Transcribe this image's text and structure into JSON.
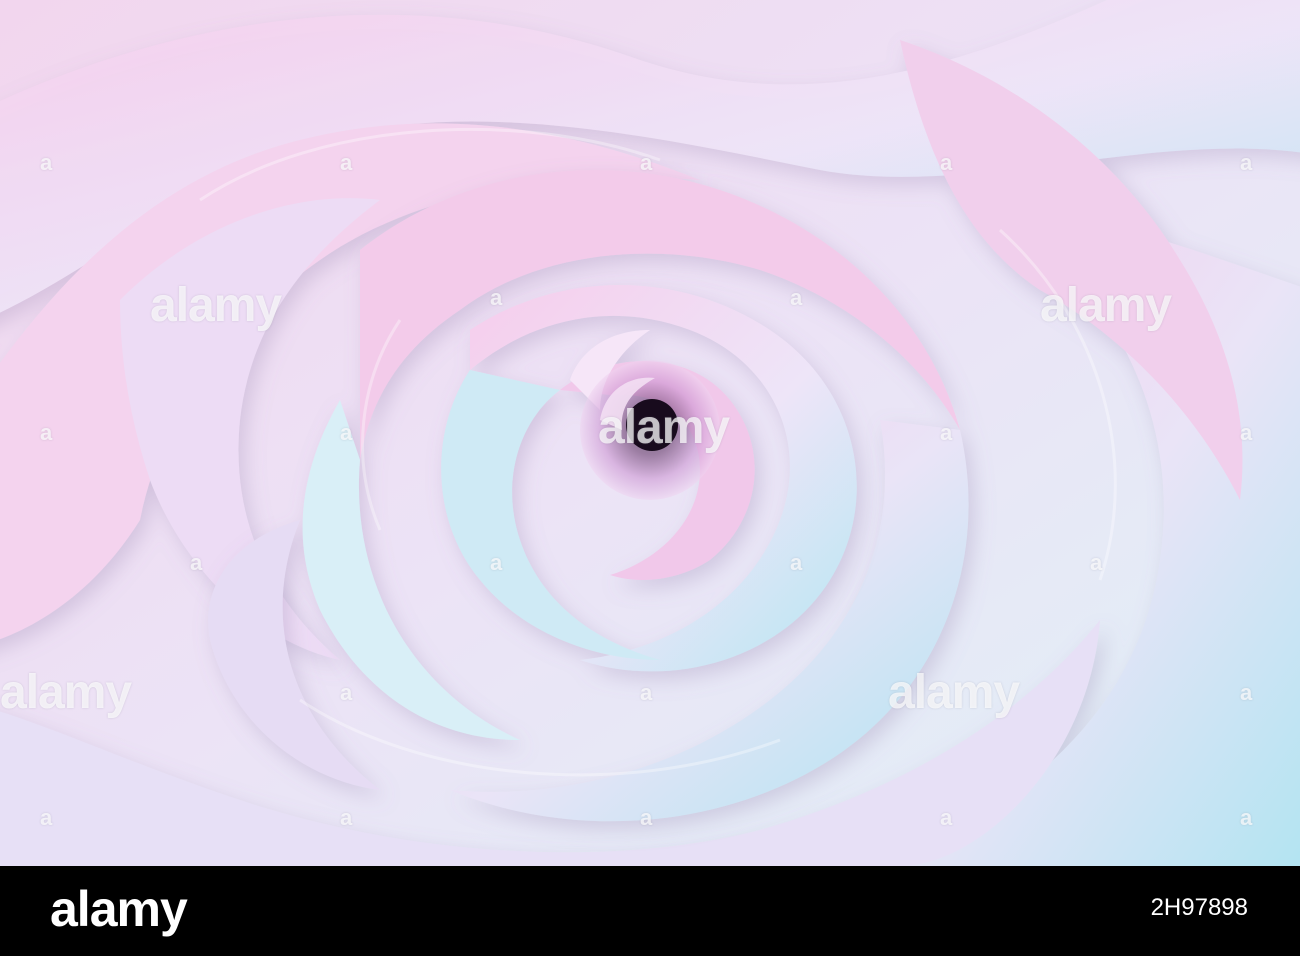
{
  "image": {
    "subject": "abstract swirling pastel pink and blue 3D spiral",
    "colors": {
      "pink": "#f3c8ea",
      "lavender": "#e8dcf5",
      "blue": "#a9e3f0",
      "white": "#f6f2fb",
      "center": "#2a1630"
    }
  },
  "watermark": {
    "text": "alamy",
    "mark": "a"
  },
  "footer": {
    "brand": "alamy",
    "image_id": "2H97898"
  }
}
